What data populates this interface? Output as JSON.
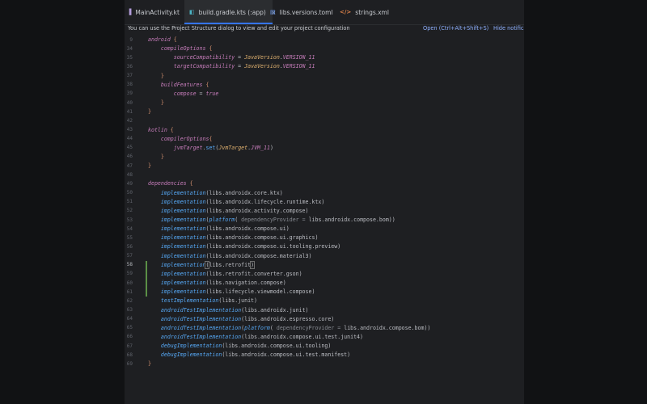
{
  "tabs": [
    {
      "label": "MainActivity.kt",
      "icon": "kotlin-file-icon",
      "active": false
    },
    {
      "label": "build.gradle.kts (:app)",
      "icon": "gradle-file-icon",
      "active": true
    },
    {
      "label": "libs.versions.toml",
      "icon": "toml-file-icon",
      "active": false
    },
    {
      "label": "strings.xml",
      "icon": "xml-file-icon",
      "active": false
    }
  ],
  "banner": {
    "message": "You can use the Project Structure dialog to view and edit your project configuration",
    "open_link": "Open (Ctrl+Alt+Shift+S)",
    "hide_link": "Hide notifica"
  },
  "editor": {
    "current_line": "58",
    "line_numbers": [
      "9",
      "34",
      "35",
      "36",
      "37",
      "38",
      "39",
      "40",
      "41",
      "42",
      "43",
      "44",
      "45",
      "46",
      "47",
      "48",
      "49",
      "50",
      "51",
      "52",
      "53",
      "54",
      "55",
      "56",
      "57",
      "58",
      "59",
      "60",
      "61",
      "62",
      "63",
      "64",
      "65",
      "66",
      "67",
      "68",
      "69"
    ],
    "changed_lines": [
      "58",
      "59",
      "60",
      "61"
    ],
    "lines": [
      {
        "t": [
          [
            "android",
            "kw"
          ],
          [
            " {",
            "br"
          ]
        ]
      },
      {
        "t": [
          [
            "    "
          ],
          [
            "compileOptions",
            "kw"
          ],
          [
            " {",
            "br"
          ]
        ]
      },
      {
        "t": [
          [
            "        "
          ],
          [
            "sourceCompatibility",
            "pr"
          ],
          [
            " = "
          ],
          [
            "JavaVersion",
            "cls"
          ],
          [
            "."
          ],
          [
            "VERSION_11",
            "fld"
          ]
        ]
      },
      {
        "t": [
          [
            "        "
          ],
          [
            "targetCompatibility",
            "pr"
          ],
          [
            " = "
          ],
          [
            "JavaVersion",
            "cls"
          ],
          [
            "."
          ],
          [
            "VERSION_11",
            "fld"
          ]
        ]
      },
      {
        "t": [
          [
            "    "
          ],
          [
            "}",
            "br"
          ]
        ]
      },
      {
        "t": [
          [
            "    "
          ],
          [
            "buildFeatures",
            "kw"
          ],
          [
            " {",
            "br"
          ]
        ]
      },
      {
        "t": [
          [
            "        "
          ],
          [
            "compose",
            "pr"
          ],
          [
            " = "
          ],
          [
            "true",
            "kw"
          ]
        ]
      },
      {
        "t": [
          [
            "    "
          ],
          [
            "}",
            "br"
          ]
        ]
      },
      {
        "t": [
          [
            "}",
            "br"
          ]
        ]
      },
      {
        "t": []
      },
      {
        "t": [
          [
            "kotlin",
            "kw"
          ],
          [
            " {",
            "br"
          ]
        ]
      },
      {
        "t": [
          [
            "    "
          ],
          [
            "compilerOptions",
            "kw"
          ],
          [
            "{",
            "br"
          ]
        ]
      },
      {
        "t": [
          [
            "        "
          ],
          [
            "jvmTarget",
            "pr"
          ],
          [
            "."
          ],
          [
            "set",
            "fn"
          ],
          [
            "("
          ],
          [
            "JvmTarget",
            "cls"
          ],
          [
            "."
          ],
          [
            "JVM_11",
            "fld"
          ],
          [
            ")"
          ]
        ]
      },
      {
        "t": [
          [
            "    "
          ],
          [
            "}",
            "br"
          ]
        ]
      },
      {
        "t": [
          [
            "}",
            "br"
          ]
        ]
      },
      {
        "t": []
      },
      {
        "t": [
          [
            "dependencies",
            "kw"
          ],
          [
            " {",
            "br"
          ]
        ]
      },
      {
        "t": [
          [
            "    "
          ],
          [
            "implementation",
            "hl"
          ],
          [
            "(libs.androidx.core.ktx)"
          ]
        ]
      },
      {
        "t": [
          [
            "    "
          ],
          [
            "implementation",
            "hl"
          ],
          [
            "(libs.androidx.lifecycle.runtime.ktx)"
          ]
        ]
      },
      {
        "t": [
          [
            "    "
          ],
          [
            "implementation",
            "hl"
          ],
          [
            "(libs.androidx.activity.compose)"
          ]
        ]
      },
      {
        "t": [
          [
            "    "
          ],
          [
            "implementation",
            "hl"
          ],
          [
            "("
          ],
          [
            "platform",
            "hl"
          ],
          [
            "( "
          ],
          [
            "dependencyProvider = ",
            "hint"
          ],
          [
            "libs.androidx.compose.bom))"
          ]
        ]
      },
      {
        "t": [
          [
            "    "
          ],
          [
            "implementation",
            "hl"
          ],
          [
            "(libs.androidx.compose.ui)"
          ]
        ]
      },
      {
        "t": [
          [
            "    "
          ],
          [
            "implementation",
            "hl"
          ],
          [
            "(libs.androidx.compose.ui.graphics)"
          ]
        ]
      },
      {
        "t": [
          [
            "    "
          ],
          [
            "implementation",
            "hl"
          ],
          [
            "(libs.androidx.compose.ui.tooling.preview)"
          ]
        ]
      },
      {
        "t": [
          [
            "    "
          ],
          [
            "implementation",
            "hl"
          ],
          [
            "(libs.androidx.compose.material3)"
          ]
        ]
      },
      {
        "t": [
          [
            "    "
          ],
          [
            "implementation",
            "hl"
          ],
          [
            "(",
            "bm"
          ],
          [
            "libs.retrofit"
          ],
          [
            ")",
            "bm"
          ]
        ]
      },
      {
        "t": [
          [
            "    "
          ],
          [
            "implementation",
            "hl"
          ],
          [
            "(libs.retrofit.converter.gson)"
          ]
        ]
      },
      {
        "t": [
          [
            "    "
          ],
          [
            "implementation",
            "hl"
          ],
          [
            "(libs.navigation.compose)"
          ]
        ]
      },
      {
        "t": [
          [
            "    "
          ],
          [
            "implementation",
            "hl"
          ],
          [
            "(libs.lifecycle.viewmodel.compose)"
          ]
        ]
      },
      {
        "t": [
          [
            "    "
          ],
          [
            "testImplementation",
            "hl"
          ],
          [
            "(libs.junit)"
          ]
        ]
      },
      {
        "t": [
          [
            "    "
          ],
          [
            "androidTestImplementation",
            "hl"
          ],
          [
            "(libs.androidx.junit)"
          ]
        ]
      },
      {
        "t": [
          [
            "    "
          ],
          [
            "androidTestImplementation",
            "hl"
          ],
          [
            "(libs.androidx.espresso.core)"
          ]
        ]
      },
      {
        "t": [
          [
            "    "
          ],
          [
            "androidTestImplementation",
            "hl"
          ],
          [
            "("
          ],
          [
            "platform",
            "hl"
          ],
          [
            "( "
          ],
          [
            "dependencyProvider = ",
            "hint"
          ],
          [
            "libs.androidx.compose.bom))"
          ]
        ]
      },
      {
        "t": [
          [
            "    "
          ],
          [
            "androidTestImplementation",
            "hl"
          ],
          [
            "(libs.androidx.compose.ui.test.junit4)"
          ]
        ]
      },
      {
        "t": [
          [
            "    "
          ],
          [
            "debugImplementation",
            "hl"
          ],
          [
            "(libs.androidx.compose.ui.tooling)"
          ]
        ]
      },
      {
        "t": [
          [
            "    "
          ],
          [
            "debugImplementation",
            "hl"
          ],
          [
            "(libs.androidx.compose.ui.test.manifest)"
          ]
        ]
      },
      {
        "t": [
          [
            "}",
            "br"
          ]
        ]
      }
    ]
  }
}
